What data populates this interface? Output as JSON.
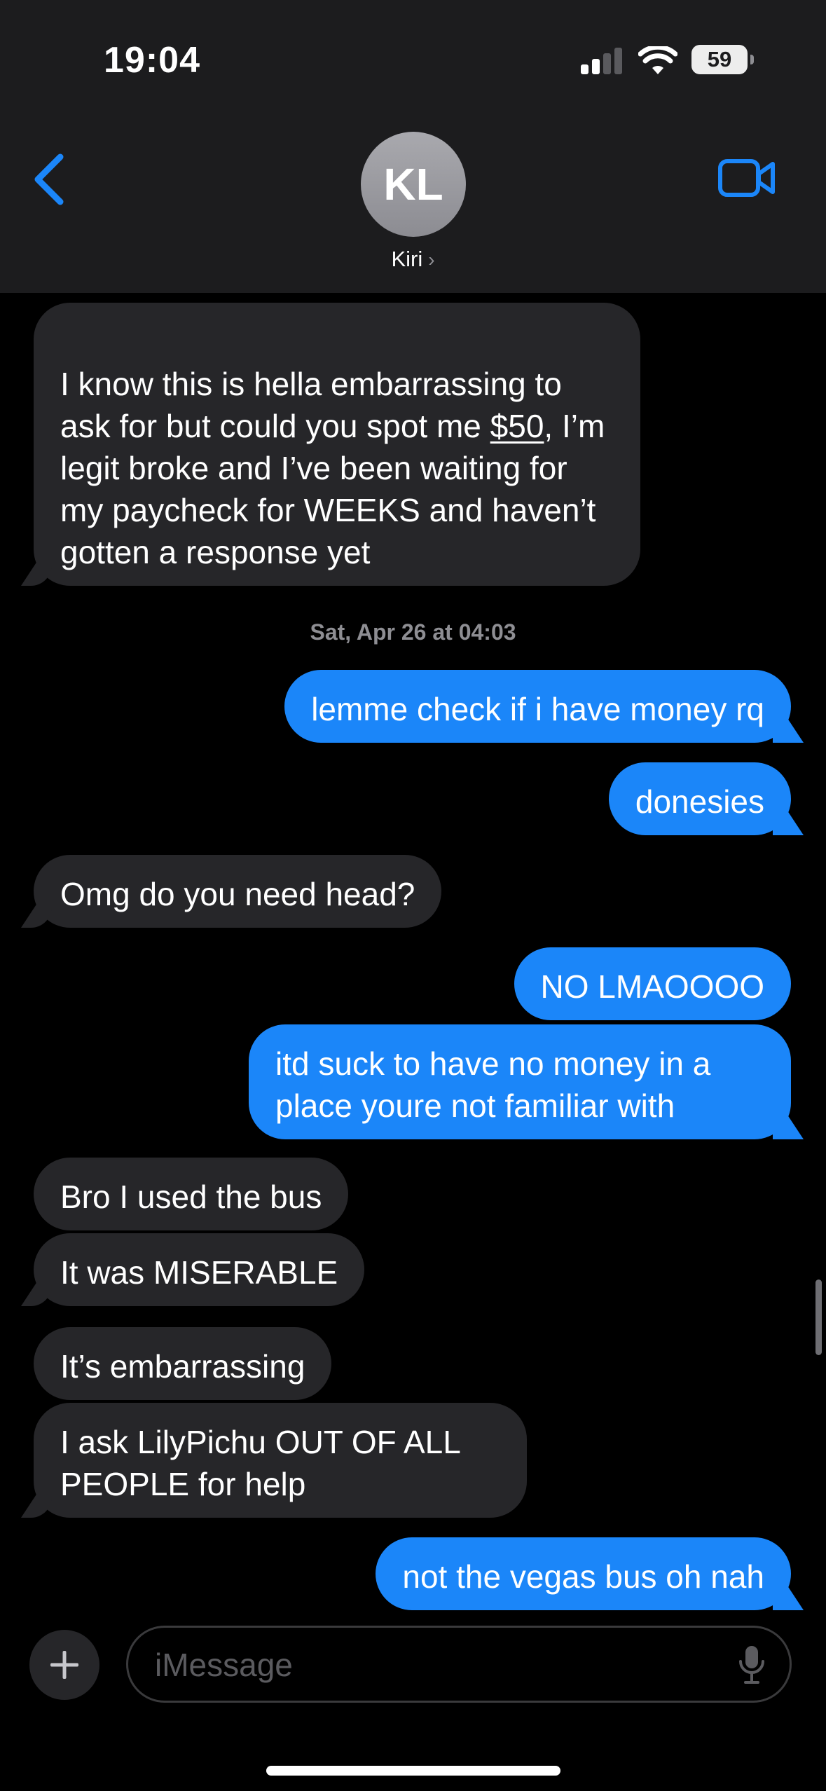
{
  "status_bar": {
    "time": "19:04",
    "battery": "59"
  },
  "header": {
    "avatar_initials": "KL",
    "contact_name": "Kiri",
    "contact_chevron": "›"
  },
  "messages": [
    {
      "direction": "in",
      "text_before": "I know this is hella embarrassing to ask for but could you spot me ",
      "link_text": "$50",
      "text_after": ", I’m legit broke and I’ve been waiting for my paycheck for WEEKS and haven’t gotten a response yet"
    },
    {
      "direction": "out",
      "text": "lemme check if i have money rq"
    },
    {
      "direction": "out",
      "text": "donesies"
    },
    {
      "direction": "in",
      "text": "Omg do you need head?"
    },
    {
      "direction": "out",
      "text": "NO LMAOOOO"
    },
    {
      "direction": "out",
      "text": "itd suck to have no money in a place youre not familiar with"
    },
    {
      "direction": "in",
      "text": "Bro I used the bus"
    },
    {
      "direction": "in",
      "text": "It was MISERABLE"
    },
    {
      "direction": "in",
      "text": "It’s embarrassing"
    },
    {
      "direction": "in",
      "text": "I ask LilyPichu OUT OF ALL PEOPLE for help"
    },
    {
      "direction": "out",
      "text": "not the vegas bus oh nah"
    }
  ],
  "timestamp": "Sat, Apr 26 at 04:03",
  "composer": {
    "placeholder": "iMessage",
    "value": ""
  },
  "icons": {
    "back": "chevron-left-icon",
    "video": "video-camera-icon",
    "add": "plus-icon",
    "mic": "microphone-icon",
    "signal": "cellular-signal-icon",
    "wifi": "wifi-icon",
    "battery": "battery-icon"
  },
  "colors": {
    "accent": "#1b86f9",
    "incoming_bubble": "#262629",
    "header_bg": "#1c1c1e",
    "background": "#000000"
  }
}
